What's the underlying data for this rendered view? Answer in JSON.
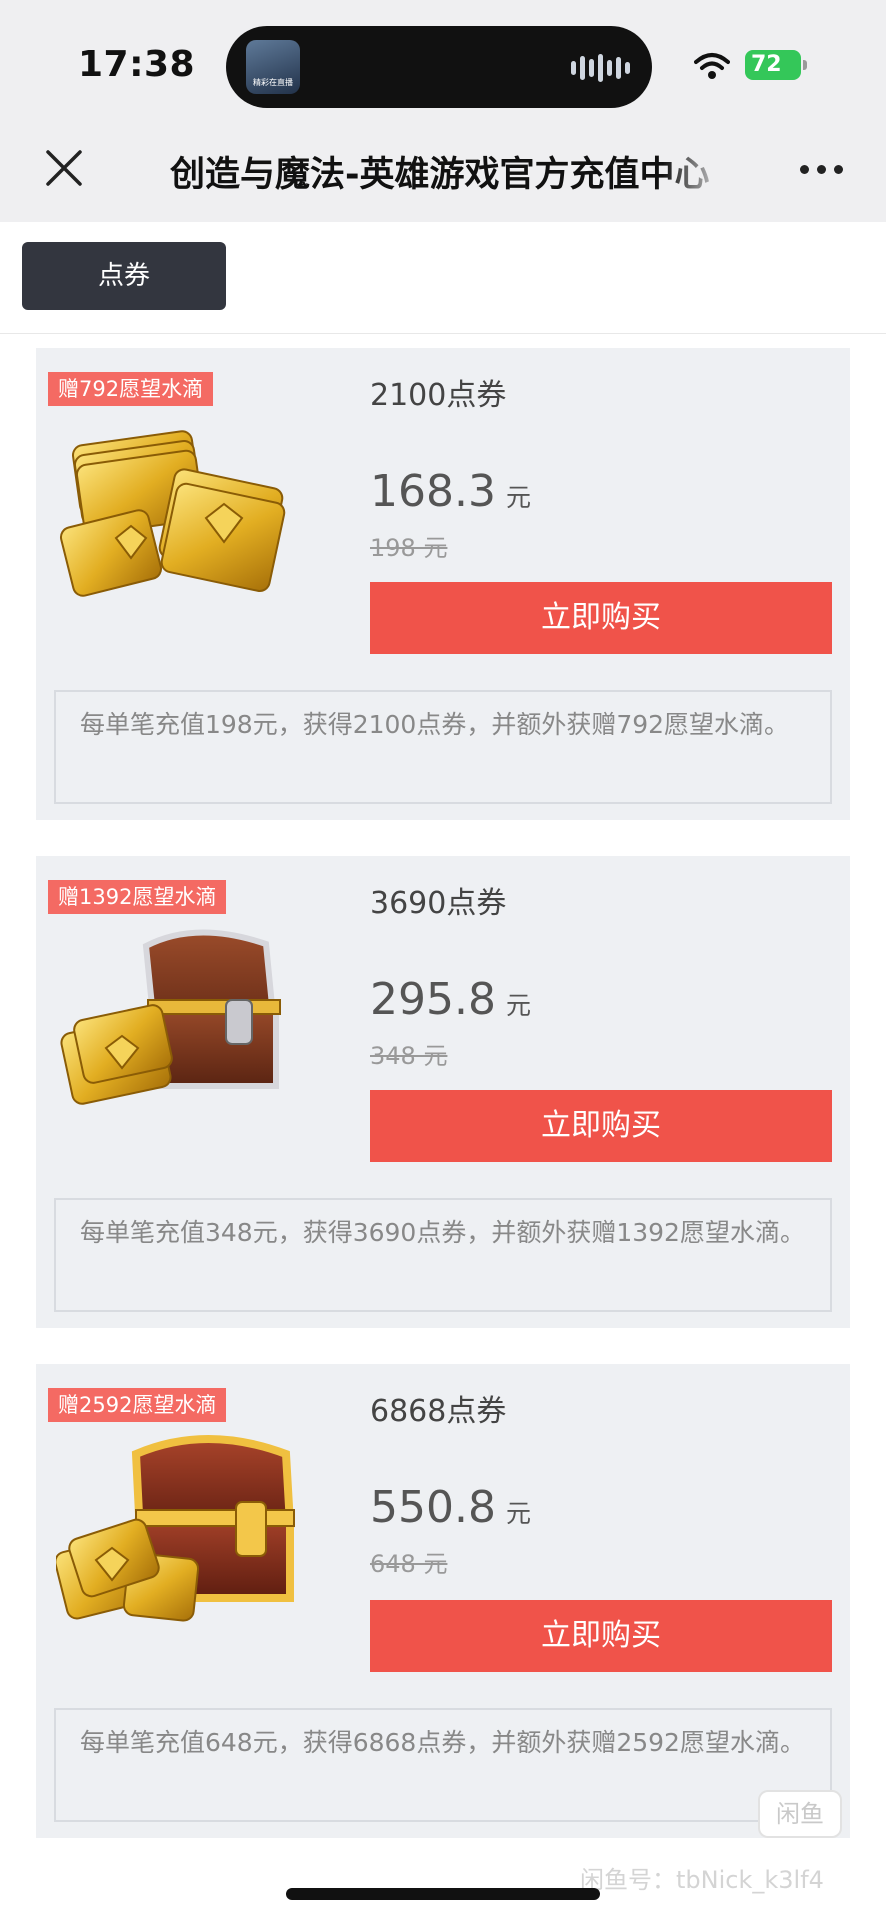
{
  "status_bar": {
    "time": "17:38",
    "island_thumb_text": "精彩在直播",
    "battery": "72"
  },
  "nav": {
    "title": "创造与魔法-英雄游戏官方充值中心"
  },
  "tabs": [
    {
      "label": "点券",
      "active": true
    }
  ],
  "products": [
    {
      "badge": "赠792愿望水滴",
      "name": "2100点券",
      "price": "168.3",
      "unit": "元",
      "original_price": "198 元",
      "buy_label": "立即购买",
      "description": "每单笔充值198元，获得2100点券，并额外获赠792愿望水滴。",
      "art": "coin-stack"
    },
    {
      "badge": "赠1392愿望水滴",
      "name": "3690点券",
      "price": "295.8",
      "unit": "元",
      "original_price": "348 元",
      "buy_label": "立即购买",
      "description": "每单笔充值348元，获得3690点券，并额外获赠1392愿望水滴。",
      "art": "small-chest"
    },
    {
      "badge": "赠2592愿望水滴",
      "name": "6868点券",
      "price": "550.8",
      "unit": "元",
      "original_price": "648 元",
      "buy_label": "立即购买",
      "description": "每单笔充值648元，获得6868点券，并额外获赠2592愿望水滴。",
      "art": "large-chest"
    }
  ],
  "watermark": {
    "logo": "闲鱼",
    "text": "闲鱼号：tbNick_k3lf4"
  },
  "colors": {
    "buy_button": "#f0534a",
    "badge": "#f46a63",
    "tab_active": "#33363f",
    "card_bg": "#eef0f3"
  }
}
